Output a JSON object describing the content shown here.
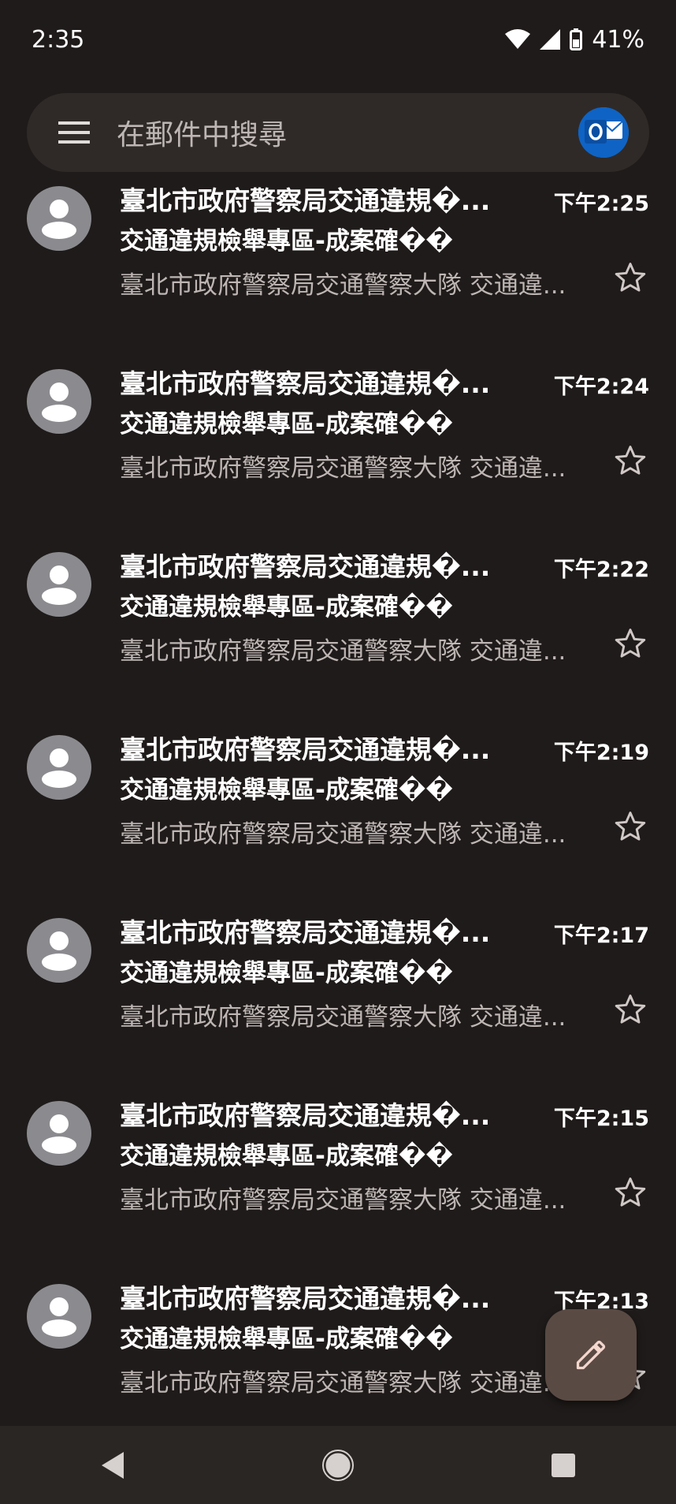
{
  "status": {
    "time": "2:35",
    "battery": "41%"
  },
  "search": {
    "placeholder": "在郵件中搜尋"
  },
  "emails": [
    {
      "sender": "臺北市政府警察局交通違規�...",
      "time": "下午2:25",
      "subject": "交通違規檢舉專區-成案確��",
      "snippet": "臺北市政府警察局交通警察大隊 交通違..."
    },
    {
      "sender": "臺北市政府警察局交通違規�...",
      "time": "下午2:24",
      "subject": "交通違規檢舉專區-成案確��",
      "snippet": "臺北市政府警察局交通警察大隊 交通違..."
    },
    {
      "sender": "臺北市政府警察局交通違規�...",
      "time": "下午2:22",
      "subject": "交通違規檢舉專區-成案確��",
      "snippet": "臺北市政府警察局交通警察大隊 交通違..."
    },
    {
      "sender": "臺北市政府警察局交通違規�...",
      "time": "下午2:19",
      "subject": "交通違規檢舉專區-成案確��",
      "snippet": "臺北市政府警察局交通警察大隊 交通違..."
    },
    {
      "sender": "臺北市政府警察局交通違規�...",
      "time": "下午2:17",
      "subject": "交通違規檢舉專區-成案確��",
      "snippet": "臺北市政府警察局交通警察大隊 交通違..."
    },
    {
      "sender": "臺北市政府警察局交通違規�...",
      "time": "下午2:15",
      "subject": "交通違規檢舉專區-成案確��",
      "snippet": "臺北市政府警察局交通警察大隊 交通違..."
    },
    {
      "sender": "臺北市政府警察局交通違規�...",
      "time": "下午2:13",
      "subject": "交通違規檢舉專區-成案確��",
      "snippet": "臺北市政府警察局交通警察大隊 交通違..."
    }
  ],
  "icons": {
    "menu": "menu-icon",
    "avatar": "person-icon",
    "star": "star-outline-icon",
    "compose": "pencil-icon",
    "back": "back-triangle-icon",
    "home": "home-circle-icon",
    "recents": "recents-square-icon"
  },
  "colors": {
    "background": "#1f1b1a",
    "search_bar": "#2f2a28",
    "fab": "#5a4a44",
    "avatar": "#8b8b8f"
  }
}
